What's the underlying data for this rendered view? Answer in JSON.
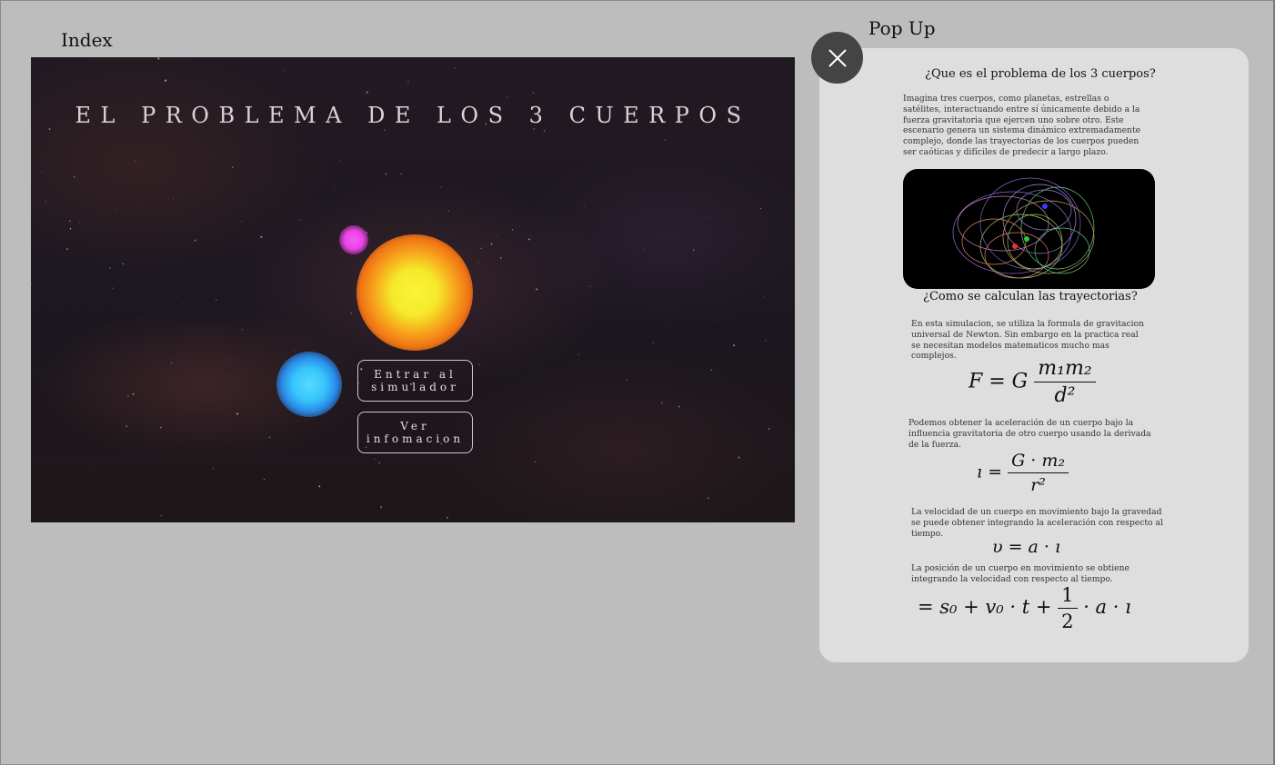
{
  "frames": {
    "index_label": "Index",
    "popup_label": "Pop Up"
  },
  "index": {
    "title": "EL PROBLEMA DE LOS 3 CUERPOS",
    "buttons": {
      "enter": "Entrar al\nsimulador",
      "info": "Ver\ninfomacion"
    },
    "bodies": {
      "sun_color": "#f9f53a",
      "pink_color": "#ec42e8",
      "blue_color": "#38c4fb"
    }
  },
  "popup": {
    "close_icon": "close-icon",
    "heading1": "¿Que es el problema de los 3 cuerpos?",
    "para1": "Imagina tres cuerpos, como planetas, estrellas o satélites, interactuando entre sí únicamente debido a la fuerza gravitatoria que ejercen uno sobre otro. Este escenario genera un sistema dinámico extremadamente complejo, donde las trayectorias de los cuerpos pueden ser caóticas y difíciles de predecir a largo plazo.",
    "heading2": "¿Como se calculan las trayectorias?",
    "para2": "En esta simulacion, se utiliza la formula de gravitacion universal de Newton. Sin embargo en la practica real se necesitan modelos matematicos mucho mas complejos.",
    "para3": "Podemos obtener la aceleración de un cuerpo bajo la influencia gravitatoria de otro cuerpo usando la derivada de la fuerza.",
    "para4": "La velocidad de un cuerpo en movimiento bajo la gravedad se puede obtener integrando la aceleración con respecto al tiempo.",
    "para5": "La posición de un cuerpo en movimiento se obtiene integrando la velocidad con respecto al tiempo.",
    "formulas": {
      "force_lhs": "F = G",
      "force_num": "m₁m₂",
      "force_den": "d²",
      "accel_lhs": "ı =",
      "accel_num": "G · m₂",
      "accel_den": "r²",
      "velocity": "υ = a · ı",
      "position_lhs": "= s₀ + v₀ · t +",
      "position_num": "1",
      "position_den": "2",
      "position_rhs": "· a · ı"
    }
  }
}
